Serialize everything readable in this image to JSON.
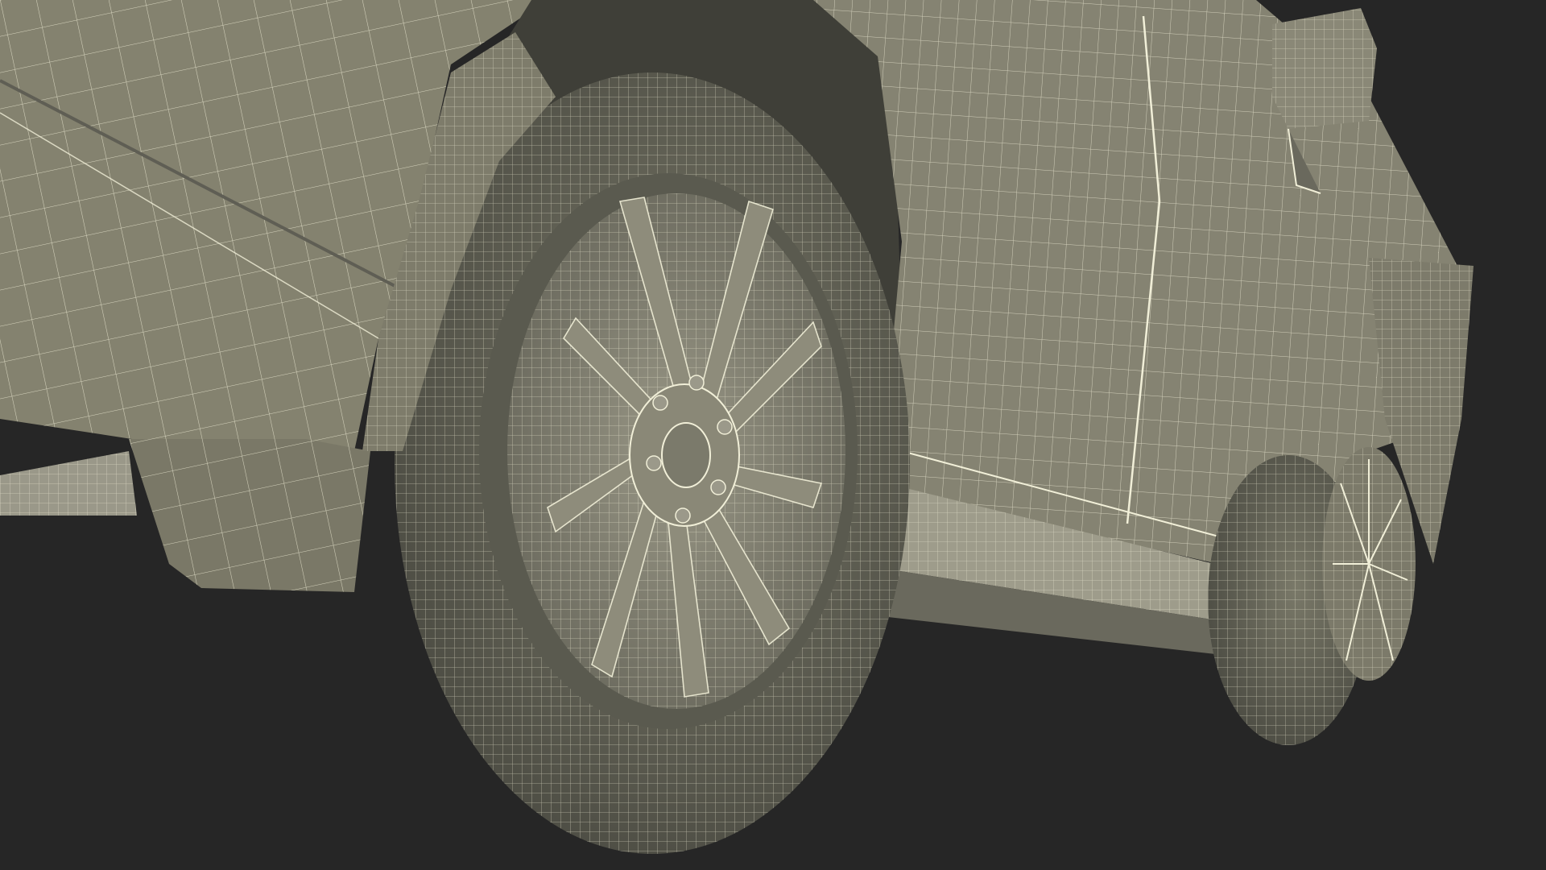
{
  "scene": {
    "subject": "wireframe-suv-render",
    "colors": {
      "background": "#262626",
      "body_fill": "#848274",
      "body_shadow": "#5f5e54",
      "body_light": "#9a9889",
      "tire_fill": "#6f6e62",
      "tire_dark": "#4a4a41",
      "rim_fill": "#8b8979",
      "wire": "#f1efd8",
      "well_dark": "#2f2f2a"
    }
  }
}
